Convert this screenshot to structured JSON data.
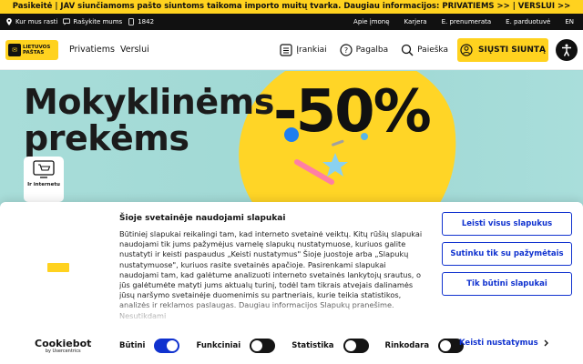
{
  "announcement": "Pasikeitė | JAV siunčiamoms pašto siuntoms taikoma importo muitų tvarka. Daugiau informacijos: PRIVATIEMS >> | VERSLUI >>",
  "utility": {
    "find": "Kur mus rasti",
    "write": "Rašykite mums",
    "phone": "1842",
    "links": [
      "Apie įmonę",
      "Karjera",
      "E. prenumerata",
      "E. parduotuvė",
      "EN"
    ]
  },
  "header": {
    "logo_line1": "LIETUVOS",
    "logo_line2": "PAŠTAS",
    "nav": [
      "Privatiems",
      "Verslui"
    ],
    "tools": {
      "tools_label": "Įrankiai",
      "help_label": "Pagalba",
      "search_label": "Paieška"
    },
    "send_label": "SIŲSTI SIUNTĄ"
  },
  "hero": {
    "title_line1": "Mokyklinėms",
    "title_line2": "prekėms",
    "discount": "-50%",
    "badge_label": "Ir internetu"
  },
  "cookie": {
    "title": "Šioje svetainėje naudojami slapukai",
    "body": "Būtiniej slapukai reikalingi tam, kad interneto svetainė veiktų. Kitų rūšių slapukai naudojami tik jums pažymėjus varnelę slapukų nustatymuose, kuriuos galite nustatyti ir keisti paspaudus „Keisti nustatymus\" Šioje juostoje arba „Slapukų nustatymuose\", kuriuos rasite svetainės apačioje. Pasirenkami slapukai naudojami tam, kad galėtume analizuoti interneto svetainės lankytojų srautus, o jūs galėtumėte matyti jums aktualų turinį, todėl tam tikrais atvejais dalinamės jūsų naršymo svetainėje duomenimis su partneriais, kurie teikia statistikos, analizės ir reklamos paslaugas. Daugiau informacijos Slapukų pranešime. Nesutikdami",
    "buttons": [
      "Leisti visus slapukus",
      "Sutinku tik su pažymėtais",
      "Tik būtini slapukai"
    ],
    "powered_name": "Cookiebot",
    "powered_by": "by Usercentrics",
    "toggles": [
      {
        "label": "Būtini",
        "on": true
      },
      {
        "label": "Funkciniai",
        "on": false
      },
      {
        "label": "Statistika",
        "on": false
      },
      {
        "label": "Rinkodara",
        "on": false
      }
    ],
    "details_label": "Keisti nustatymus"
  },
  "colors": {
    "brand_yellow": "#ffd21f",
    "cookie_blue": "#1032cf",
    "hero_bg": "#a6dcd9"
  }
}
